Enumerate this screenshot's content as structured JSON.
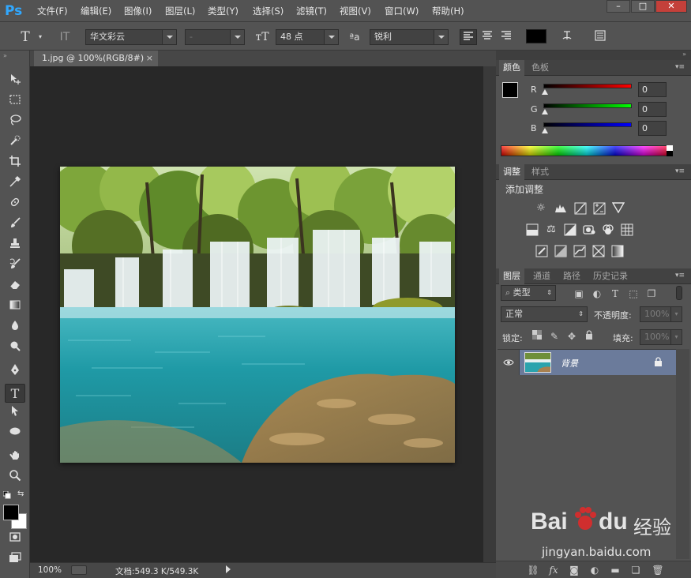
{
  "app": {
    "logo": "Ps",
    "menu": [
      "文件(F)",
      "编辑(E)",
      "图像(I)",
      "图层(L)",
      "类型(Y)",
      "选择(S)",
      "滤镜(T)",
      "视图(V)",
      "窗口(W)",
      "帮助(H)"
    ],
    "window_controls": [
      "–",
      "□",
      "✕"
    ]
  },
  "options": {
    "font_family": "华文彩云",
    "font_style": "-",
    "font_size": "48 点",
    "aa_label": "ªa",
    "antialias": "锐利",
    "text_color": "#000000"
  },
  "document": {
    "tab_title": "1.jpg @ 100%(RGB/8#)",
    "close": "×",
    "zoom": "100%",
    "doc_info": "文档:549.3 K/549.3K"
  },
  "color_panel": {
    "tabs": [
      "颜色",
      "色板"
    ],
    "channels": [
      {
        "label": "R",
        "value": "0"
      },
      {
        "label": "G",
        "value": "0"
      },
      {
        "label": "B",
        "value": "0"
      }
    ],
    "foreground": "#000000",
    "background": "#ffffff"
  },
  "adjust_panel": {
    "tabs": [
      "调整",
      "样式"
    ],
    "title": "添加调整"
  },
  "layers_panel": {
    "tabs": [
      "图层",
      "通道",
      "路径",
      "历史记录"
    ],
    "filter_type": "类型",
    "blend_mode": "正常",
    "opacity_label": "不透明度:",
    "opacity_value": "100%",
    "lock_label": "锁定:",
    "fill_label": "填充:",
    "fill_value": "100%",
    "layers": [
      {
        "name": "背景",
        "visible": true,
        "locked": true
      }
    ]
  },
  "watermark": {
    "brand": "Bai",
    "brand2": "du",
    "cn": "经验",
    "url": "jingyan.baidu.com"
  }
}
